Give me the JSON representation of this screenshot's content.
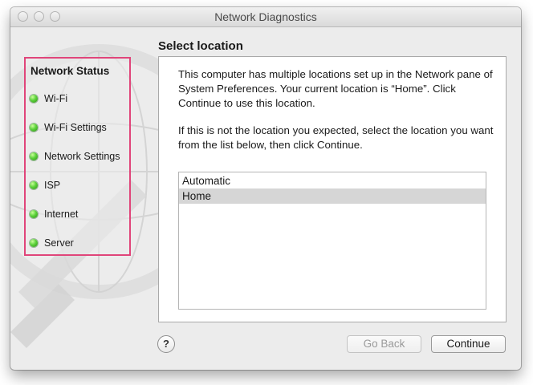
{
  "window": {
    "title": "Network Diagnostics"
  },
  "sidebar": {
    "heading": "Network Status",
    "items": [
      {
        "label": "Wi-Fi",
        "status": "green"
      },
      {
        "label": "Wi-Fi Settings",
        "status": "green"
      },
      {
        "label": "Network Settings",
        "status": "green"
      },
      {
        "label": "ISP",
        "status": "green"
      },
      {
        "label": "Internet",
        "status": "green"
      },
      {
        "label": "Server",
        "status": "green"
      }
    ],
    "highlight_color": "#e0457a"
  },
  "main": {
    "title": "Select location",
    "paragraph1": "This computer has multiple locations set up in the Network pane of System Preferences. Your current location is “Home”. Click Continue to use this location.",
    "paragraph2": "If this is not the location you expected, select the location you want from the list below, then click Continue.",
    "locations": [
      {
        "label": "Automatic",
        "selected": false
      },
      {
        "label": "Home",
        "selected": true
      }
    ]
  },
  "footer": {
    "help_label": "?",
    "back_label": "Go Back",
    "continue_label": "Continue"
  }
}
